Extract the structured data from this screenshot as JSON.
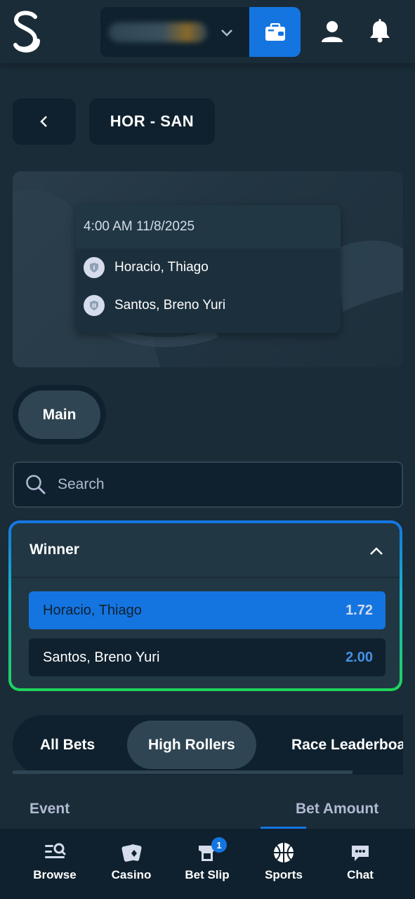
{
  "header": {
    "logo_icon": "stake-s-logo",
    "wallet_icon": "wallet-icon",
    "user_icon": "user-icon",
    "notifications_icon": "bell-icon"
  },
  "event": {
    "title": "HOR - SAN",
    "datetime": "4:00 AM 11/8/2025",
    "competitors": [
      "Horacio, Thiago",
      "Santos, Breno Yuri"
    ]
  },
  "market_tabs": {
    "active": "Main"
  },
  "search": {
    "placeholder": "Search"
  },
  "market": {
    "name": "Winner",
    "outcomes": [
      {
        "name": "Horacio, Thiago",
        "odds": "1.72",
        "selected": true
      },
      {
        "name": "Santos, Breno Yuri",
        "odds": "2.00",
        "selected": false
      }
    ]
  },
  "bets": {
    "tabs": [
      "All Bets",
      "High Rollers",
      "Race Leaderboard"
    ],
    "active_tab": "High Rollers",
    "columns": [
      "Event",
      "Bet Amount"
    ]
  },
  "bottom_nav": {
    "items": [
      {
        "label": "Browse",
        "icon": "browse-icon"
      },
      {
        "label": "Casino",
        "icon": "casino-cards-icon"
      },
      {
        "label": "Bet Slip",
        "icon": "bet-slip-icon",
        "badge": "1"
      },
      {
        "label": "Sports",
        "icon": "basketball-icon"
      },
      {
        "label": "Chat",
        "icon": "chat-icon"
      }
    ]
  },
  "colors": {
    "background": "#1a2c38",
    "panel": "#0f212e",
    "accent_blue": "#1475e1",
    "accent_green": "#1fd35a",
    "muted_text": "#b1bad3"
  }
}
